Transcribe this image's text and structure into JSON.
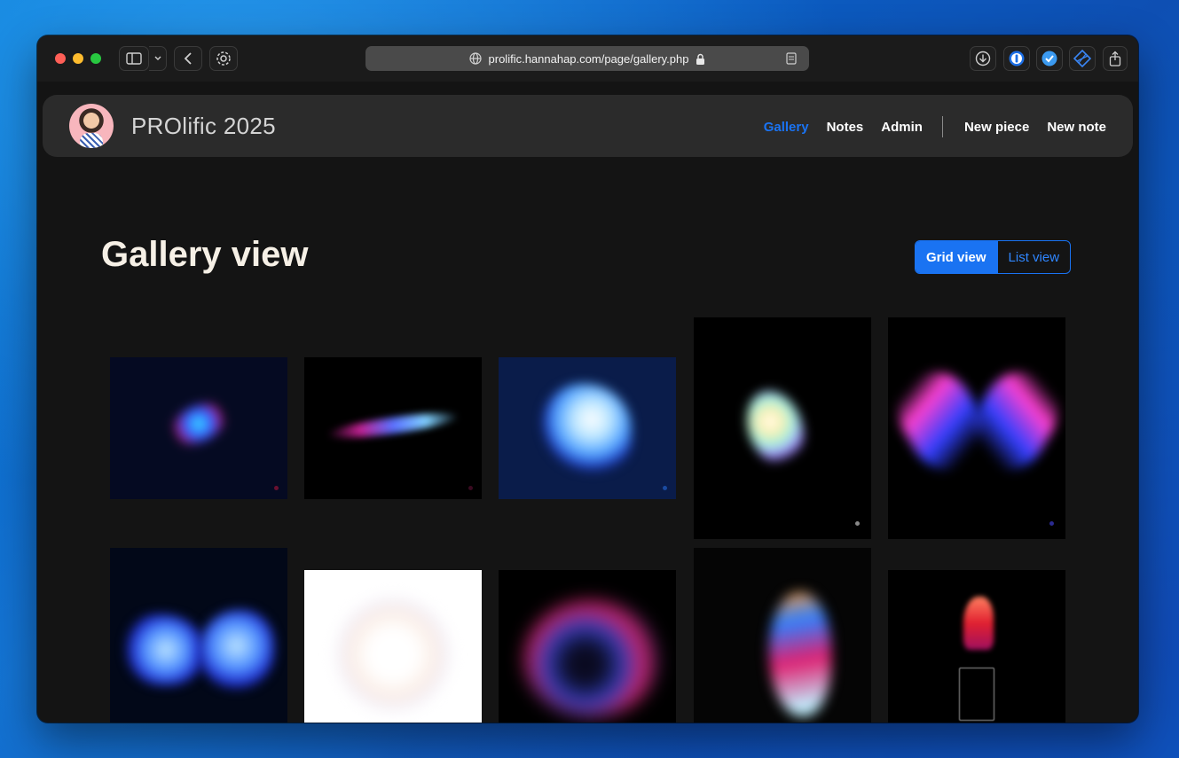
{
  "browser": {
    "url": "prolific.hannahap.com/page/gallery.php"
  },
  "site": {
    "brand": "PROlific 2025",
    "nav": {
      "gallery": "Gallery",
      "notes": "Notes",
      "admin": "Admin",
      "new_piece": "New piece",
      "new_note": "New note"
    }
  },
  "main": {
    "title": "Gallery view",
    "toggle": {
      "grid": "Grid view",
      "list": "List view"
    }
  },
  "colors": {
    "accent": "#1a73f2",
    "window_bg": "#141414",
    "navbar_bg": "#2b2b2b",
    "title_text": "#f6f0e6"
  },
  "icons": [
    "sidebar-icon",
    "chevron-down-icon",
    "back-icon",
    "gear-icon",
    "globe-icon",
    "lock-icon",
    "reader-icon",
    "download-icon",
    "password-icon",
    "check-icon",
    "extension-icon",
    "share-icon"
  ]
}
